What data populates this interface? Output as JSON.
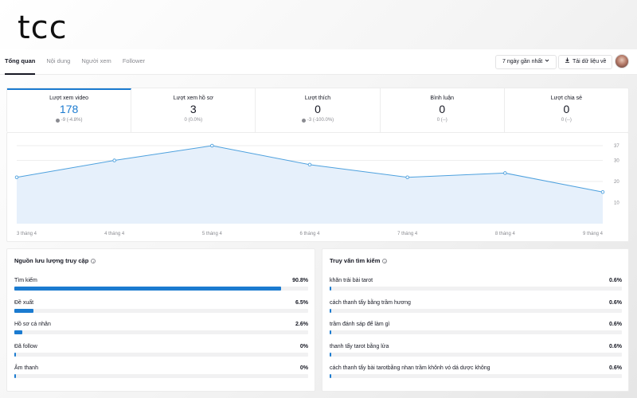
{
  "logo": "tcc",
  "tabs": [
    "Tổng quan",
    "Nội dung",
    "Người xem",
    "Follower"
  ],
  "date_range": "7 ngày gần nhất",
  "download": "Tải dữ liệu về",
  "colors": {
    "accent": "#1b7bd0",
    "line": "#4ea1de",
    "area": "#e6f0fb"
  },
  "metrics": [
    {
      "label": "Lượt xem video",
      "value": "178",
      "delta": "-9 (-4.8%)"
    },
    {
      "label": "Lượt xem hồ sơ",
      "value": "3",
      "delta": "0 (0.0%)"
    },
    {
      "label": "Lượt thích",
      "value": "0",
      "delta": "-3 (-100.0%)"
    },
    {
      "label": "Bình luận",
      "value": "0",
      "delta": "0 (--)"
    },
    {
      "label": "Lượt chia sẻ",
      "value": "0",
      "delta": "0 (--)"
    }
  ],
  "chart_data": {
    "type": "area",
    "title": "",
    "x": [
      "3 tháng 4",
      "4 tháng 4",
      "5 tháng 4",
      "6 tháng 4",
      "7 tháng 4",
      "8 tháng 4",
      "9 tháng 4"
    ],
    "y": [
      22,
      30,
      37,
      28,
      22,
      24,
      15
    ],
    "y_ticks": [
      10,
      20,
      30,
      37
    ],
    "ylim": [
      0,
      37
    ],
    "grid": true
  },
  "traffic": {
    "title": "Nguồn lưu lượng truy cập",
    "rows": [
      {
        "label": "Tìm kiếm",
        "value": "90.8%",
        "fraction": 0.908
      },
      {
        "label": "Đề xuất",
        "value": "6.5%",
        "fraction": 0.065
      },
      {
        "label": "Hồ sơ cá nhân",
        "value": "2.6%",
        "fraction": 0.026
      },
      {
        "label": "Đã follow",
        "value": "0%",
        "fraction": 0.0
      },
      {
        "label": "Âm thanh",
        "value": "0%",
        "fraction": 0.0
      }
    ]
  },
  "queries": {
    "title": "Truy vấn tìm kiếm",
    "rows": [
      {
        "label": "khăn trải bài tarot",
        "value": "0.6%",
        "fraction": 0.006
      },
      {
        "label": "cách thanh tẩy bằng trầm hương",
        "value": "0.6%",
        "fraction": 0.006
      },
      {
        "label": "trầm đánh sáp để làm gì",
        "value": "0.6%",
        "fraction": 0.006
      },
      {
        "label": "thanh tẩy tarot bằng lửa",
        "value": "0.6%",
        "fraction": 0.006
      },
      {
        "label": "cách thanh tẩy bài tarotbằng nhan trầm khônh vó dá dược không",
        "value": "0.6%",
        "fraction": 0.006
      }
    ]
  }
}
